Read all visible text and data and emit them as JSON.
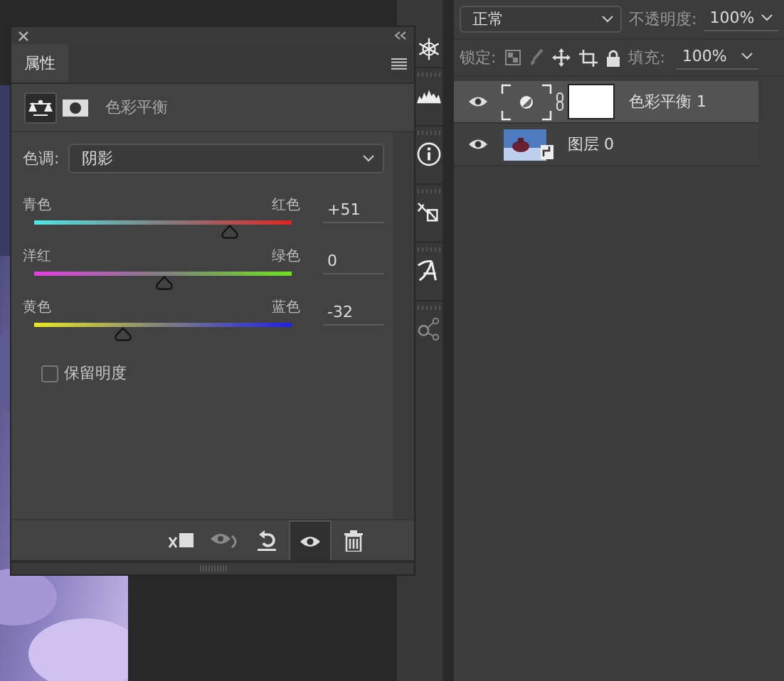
{
  "properties_panel": {
    "tab": "属性",
    "adjustment_title": "色彩平衡",
    "tone": {
      "label": "色调:",
      "value": "阴影"
    },
    "sliders": [
      {
        "left": "青色",
        "right": "红色",
        "level": 0.755,
        "value": "+51"
      },
      {
        "left": "洋红",
        "right": "绿色",
        "level": 0.5,
        "value": "0"
      },
      {
        "left": "黄色",
        "right": "蓝色",
        "level": 0.34,
        "value": "-32"
      }
    ],
    "preserve_luminosity": {
      "label": "保留明度",
      "checked": false
    },
    "footer_buttons": [
      {
        "kind": "clip",
        "disabled": false,
        "on": false
      },
      {
        "kind": "preview",
        "disabled": true,
        "on": false
      },
      {
        "kind": "reset",
        "disabled": false,
        "on": false
      },
      {
        "kind": "visibility",
        "disabled": false,
        "on": true
      },
      {
        "kind": "delete",
        "disabled": false,
        "on": false
      }
    ]
  },
  "layers_panel": {
    "blend_mode": "正常",
    "opacity_label": "不透明度:",
    "opacity": "100%",
    "lock_label": "锁定:",
    "fill_label": "填充:",
    "fill": "100%",
    "layers": [
      {
        "name": "色彩平衡 1",
        "kind": "adjustment",
        "selected": true,
        "visible": true
      },
      {
        "name": "图层 0",
        "selected": false,
        "visible": true
      }
    ]
  }
}
